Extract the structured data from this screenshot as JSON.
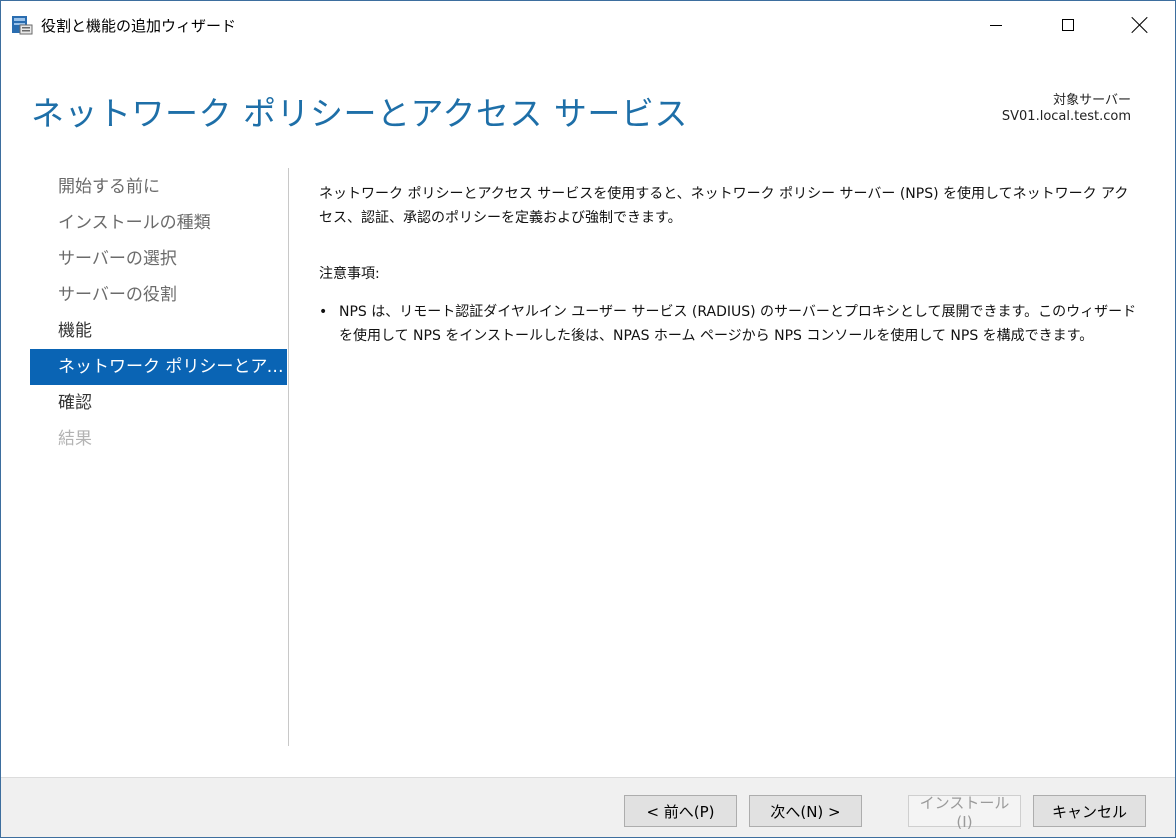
{
  "window": {
    "title": "役割と機能の追加ウィザード",
    "icon": "server-manager-wizard-icon",
    "controls": [
      "minimize-icon",
      "maximize-icon",
      "close-icon"
    ]
  },
  "header": {
    "page_title": "ネットワーク ポリシーとアクセス サービス",
    "target_label": "対象サーバー",
    "target_server": "SV01.local.test.com"
  },
  "nav": {
    "items": [
      {
        "label": "開始する前に",
        "state": "visited"
      },
      {
        "label": "インストールの種類",
        "state": "visited"
      },
      {
        "label": "サーバーの選択",
        "state": "visited"
      },
      {
        "label": "サーバーの役割",
        "state": "visited"
      },
      {
        "label": "機能",
        "state": "normal"
      },
      {
        "label": "ネットワーク ポリシーとアクセ...",
        "state": "active"
      },
      {
        "label": "確認",
        "state": "normal"
      },
      {
        "label": "結果",
        "state": "disabled"
      }
    ]
  },
  "content": {
    "description": "ネットワーク ポリシーとアクセス サービスを使用すると、ネットワーク ポリシー サーバー (NPS) を使用してネットワーク アクセス、認証、承認のポリシーを定義および強制できます。",
    "notes_label": "注意事項:",
    "notes": [
      "NPS は、リモート認証ダイヤルイン ユーザー サービス (RADIUS) のサーバーとプロキシとして展開できます。このウィザードを使用して NPS をインストールした後は、NPAS ホーム ページから NPS コンソールを使用して NPS を構成できます。"
    ]
  },
  "footer": {
    "prev_label": "< 前へ(P)",
    "next_label": "次へ(N) >",
    "install_label": "インストール(I)",
    "cancel_label": "キャンセル"
  },
  "colors": {
    "accent": "#0a64b4",
    "title_blue": "#1e6fa8",
    "footer_bg": "#f0f0f0"
  }
}
